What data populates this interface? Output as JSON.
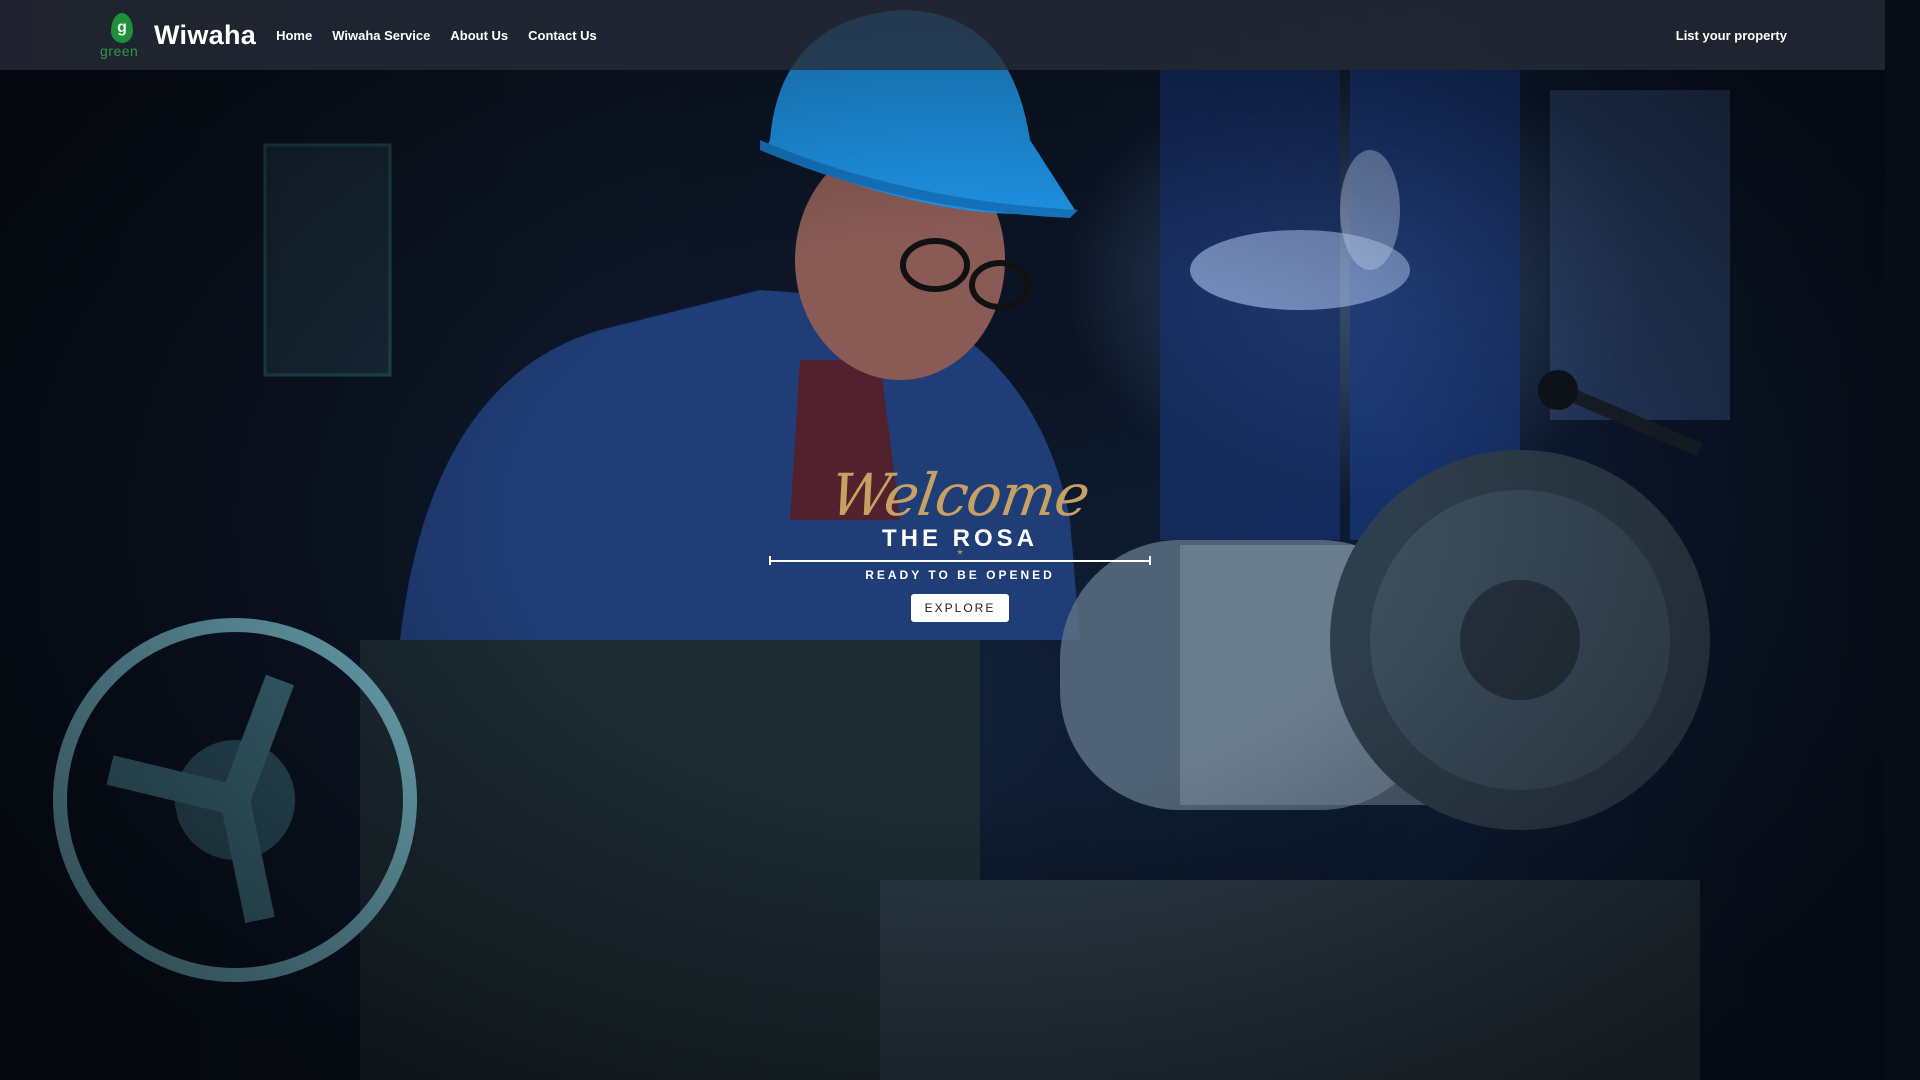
{
  "brand": {
    "logo_letter": "g",
    "logo_text": "green",
    "name": "Wiwaha"
  },
  "nav": {
    "items": [
      {
        "label": "Home"
      },
      {
        "label": "Wiwaha Service"
      },
      {
        "label": "About Us"
      },
      {
        "label": "Contact Us"
      }
    ],
    "right_label": "List your property"
  },
  "hero": {
    "welcome": "Welcome",
    "title": "THE ROSA",
    "divider_ornament": "*",
    "subtitle": "READY TO BE OPENED",
    "button_label": "EXPLORE"
  },
  "colors": {
    "accent_gold": "#c9a063",
    "brand_green": "#1f8f3a",
    "navbar_bg": "#282c38"
  }
}
